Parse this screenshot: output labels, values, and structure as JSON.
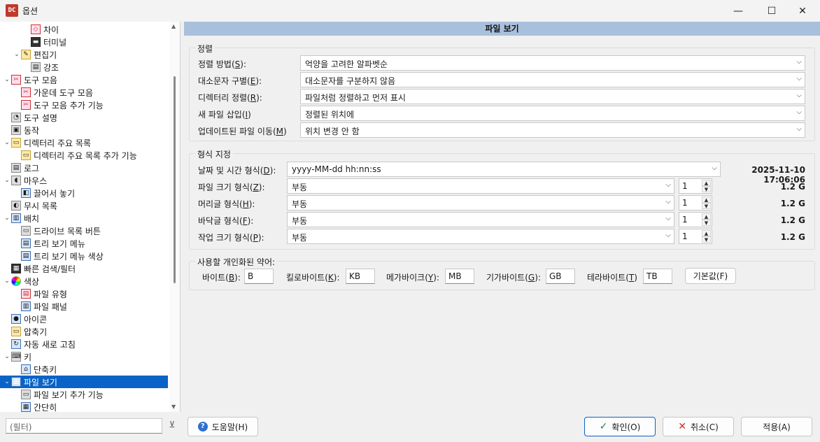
{
  "window": {
    "title": "옵션",
    "app_icon": "DC",
    "minimize": "—",
    "maximize": "☐",
    "close": "✕"
  },
  "tree": {
    "items": [
      {
        "label": "차이",
        "icon": "diff-icon"
      },
      {
        "label": "터미널",
        "icon": "terminal-icon"
      },
      {
        "label": "편집기",
        "icon": "editor-icon"
      },
      {
        "label": "강조",
        "icon": "highlight-icon"
      },
      {
        "label": "도구 모음",
        "icon": "toolbar-icon"
      },
      {
        "label": "가운데 도구 모음",
        "icon": "toolbar-middle-icon"
      },
      {
        "label": "도구 모음 추가 기능",
        "icon": "toolbar-extra-icon"
      },
      {
        "label": "도구 설명",
        "icon": "tooltip-icon"
      },
      {
        "label": "동작",
        "icon": "behavior-icon"
      },
      {
        "label": "디렉터리 주요 목록",
        "icon": "hotlist-icon"
      },
      {
        "label": "디렉터리 주요 목록 추가 기능",
        "icon": "hotlist-extra-icon"
      },
      {
        "label": "로그",
        "icon": "log-icon"
      },
      {
        "label": "마우스",
        "icon": "mouse-icon"
      },
      {
        "label": "끌어서 놓기",
        "icon": "drag-drop-icon"
      },
      {
        "label": "무시 목록",
        "icon": "ignore-list-icon"
      },
      {
        "label": "배치",
        "icon": "layout-icon"
      },
      {
        "label": "드라이브 목록 버튼",
        "icon": "drive-list-icon"
      },
      {
        "label": "트리 보기 메뉴",
        "icon": "tree-menu-icon"
      },
      {
        "label": "트리 보기 메뉴 색상",
        "icon": "tree-menu-color-icon"
      },
      {
        "label": "빠른 검색/필터",
        "icon": "quick-search-icon"
      },
      {
        "label": "색상",
        "icon": "colors-icon"
      },
      {
        "label": "파일 유형",
        "icon": "file-types-icon"
      },
      {
        "label": "파일 패널",
        "icon": "file-panels-icon"
      },
      {
        "label": "아이콘",
        "icon": "icons-icon"
      },
      {
        "label": "압축기",
        "icon": "archiver-icon"
      },
      {
        "label": "자동 새로 고침",
        "icon": "auto-refresh-icon"
      },
      {
        "label": "키",
        "icon": "keys-icon"
      },
      {
        "label": "단축키",
        "icon": "hotkeys-icon"
      },
      {
        "label": "파일 보기",
        "icon": "file-view-icon"
      },
      {
        "label": "파일 보기 추가 기능",
        "icon": "file-view-extra-icon"
      },
      {
        "label": "간단히",
        "icon": "brief-icon"
      }
    ],
    "selected_label": "파일 보기"
  },
  "filter": {
    "placeholder": "(필터)"
  },
  "panel": {
    "header": "파일 보기",
    "sorting": {
      "title": "정렬",
      "rows": [
        {
          "label": "정렬 방법(",
          "key": "S",
          "label_end": "):",
          "value": "억양을 고려한 알파벳순"
        },
        {
          "label": "대소문자 구별(",
          "key": "E",
          "label_end": "):",
          "value": "대소문자를 구분하지 않음"
        },
        {
          "label": "디렉터리 정렬(",
          "key": "R",
          "label_end": "):",
          "value": "파일처럼 정렬하고 먼저 표시"
        },
        {
          "label": "새 파일 삽입(",
          "key": "I",
          "label_end": ")",
          "value": "정렬된 위치에"
        },
        {
          "label": "업데이트된 파일 이동(",
          "key": "M",
          "label_end": ")",
          "value": "위치 변경 안 함"
        }
      ]
    },
    "formatting": {
      "title": "형식 지정",
      "datetime": {
        "label": "날짜 및 시간 형식(",
        "key": "D",
        "label_end": "):",
        "value": "yyyy-MM-dd hh:nn:ss",
        "preview": "2025-11-10 17:06:06"
      },
      "rows": [
        {
          "label": "파일 크기 형식(",
          "key": "Z",
          "label_end": "):",
          "value": "부동",
          "digits": "1",
          "preview": "1.2 G"
        },
        {
          "label": "머리글 형식(",
          "key": "H",
          "label_end": "):",
          "value": "부동",
          "digits": "1",
          "preview": "1.2 G"
        },
        {
          "label": "바닥글 형식(",
          "key": "F",
          "label_end": "):",
          "value": "부동",
          "digits": "1",
          "preview": "1.2 G"
        },
        {
          "label": "작업 크기 형식(",
          "key": "P",
          "label_end": "):",
          "value": "부동",
          "digits": "1",
          "preview": "1.2 G"
        }
      ]
    },
    "abbrev": {
      "title": "사용할 개인화된 약어:",
      "items": [
        {
          "label": "바이트(",
          "key": "B",
          "label_end": "):",
          "value": "B"
        },
        {
          "label": "킬로바이트(",
          "key": "K",
          "label_end": "):",
          "value": "KB"
        },
        {
          "label": "메가바이크(",
          "key": "Y",
          "label_end": "):",
          "value": "MB"
        },
        {
          "label": "기가바이트(",
          "key": "G",
          "label_end": "):",
          "value": "GB"
        },
        {
          "label": "테라바이트(",
          "key": "T",
          "label_end": ")",
          "value": "TB"
        }
      ],
      "default_button": "기본값(F)"
    }
  },
  "footer": {
    "help": "도움말(H)",
    "ok": "확인(O)",
    "cancel": "취소(C)",
    "apply": "적용(A)"
  }
}
